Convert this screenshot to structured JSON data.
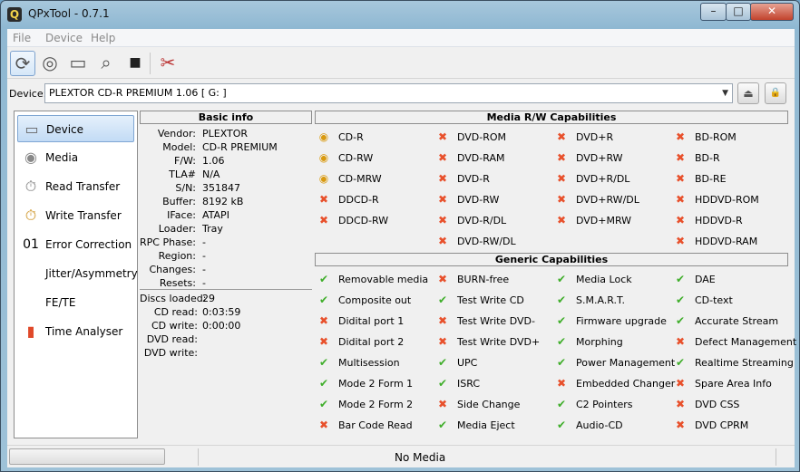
{
  "window": {
    "title": "QPxTool - 0.7.1",
    "app_icon_letter": "Q",
    "minimize": "–",
    "maximize": "□",
    "close": "✕"
  },
  "menu": [
    {
      "label": "File"
    },
    {
      "label": "Device"
    },
    {
      "label": "Help"
    }
  ],
  "toolbar": {
    "icons": [
      "refresh-icon",
      "disc-info-icon",
      "drive-icon",
      "scan-icon",
      "stop-icon",
      "settings-icon"
    ]
  },
  "device": {
    "label": "Device:",
    "value": "PLEXTOR  CD-R   PREMIUM   1.06 [ G: ]",
    "eject_label": "⏏",
    "lock_label": "🔒"
  },
  "sidebar": {
    "items": [
      {
        "label": "Device",
        "icon": "drive-icon",
        "active": true
      },
      {
        "label": "Media",
        "icon": "disc-icon"
      },
      {
        "label": "Read Transfer",
        "icon": "stopwatch-icon"
      },
      {
        "label": "Write Transfer",
        "icon": "stopwatch-burst-icon"
      },
      {
        "label": "Error Correction",
        "icon": "binary-icon",
        "icon_text": "01"
      },
      {
        "label": "Jitter/Asymmetry",
        "icon": ""
      },
      {
        "label": "FE/TE",
        "icon": ""
      },
      {
        "label": "Time Analyser",
        "icon": "bar-chart-icon"
      }
    ]
  },
  "basic_info": {
    "title": "Basic info",
    "rows": [
      {
        "key": "Vendor:",
        "value": "PLEXTOR"
      },
      {
        "key": "Model:",
        "value": "CD-R   PREMIUM"
      },
      {
        "key": "F/W:",
        "value": "1.06"
      },
      {
        "key": "TLA#",
        "value": "N/A"
      },
      {
        "key": "S/N:",
        "value": "351847"
      },
      {
        "key": "Buffer:",
        "value": "8192 kB"
      },
      {
        "key": "IFace:",
        "value": "ATAPI"
      },
      {
        "key": "Loader:",
        "value": "Tray"
      },
      {
        "key": "RPC Phase:",
        "value": "-"
      },
      {
        "key": "Region:",
        "value": "-"
      },
      {
        "key": "Changes:",
        "value": "-"
      },
      {
        "key": "Resets:",
        "value": "-"
      }
    ],
    "stats": [
      {
        "key": "Discs loaded:",
        "value": "29"
      },
      {
        "key": "CD read:",
        "value": "0:03:59"
      },
      {
        "key": "CD write:",
        "value": "0:00:00"
      },
      {
        "key": "DVD read:",
        "value": ""
      },
      {
        "key": "DVD write:",
        "value": ""
      }
    ]
  },
  "media_rw": {
    "title": "Media R/W Capabilities",
    "columns": [
      [
        {
          "label": "CD-R",
          "state": "read-write"
        },
        {
          "label": "CD-RW",
          "state": "read-write"
        },
        {
          "label": "CD-MRW",
          "state": "read-write"
        },
        {
          "label": "DDCD-R",
          "state": "no"
        },
        {
          "label": "DDCD-RW",
          "state": "no"
        }
      ],
      [
        {
          "label": "DVD-ROM",
          "state": "no"
        },
        {
          "label": "DVD-RAM",
          "state": "no"
        },
        {
          "label": "DVD-R",
          "state": "no"
        },
        {
          "label": "DVD-RW",
          "state": "no"
        },
        {
          "label": "DVD-R/DL",
          "state": "no"
        },
        {
          "label": "DVD-RW/DL",
          "state": "no"
        }
      ],
      [
        {
          "label": "DVD+R",
          "state": "no"
        },
        {
          "label": "DVD+RW",
          "state": "no"
        },
        {
          "label": "DVD+R/DL",
          "state": "no"
        },
        {
          "label": "DVD+RW/DL",
          "state": "no"
        },
        {
          "label": "DVD+MRW",
          "state": "no"
        }
      ],
      [
        {
          "label": "BD-ROM",
          "state": "no"
        },
        {
          "label": "BD-R",
          "state": "no"
        },
        {
          "label": "BD-RE",
          "state": "no"
        },
        {
          "label": "HDDVD-ROM",
          "state": "no"
        },
        {
          "label": "HDDVD-R",
          "state": "no"
        },
        {
          "label": "HDDVD-RAM",
          "state": "no"
        }
      ]
    ]
  },
  "generic": {
    "title": "Generic Capabilities",
    "columns": [
      [
        {
          "label": "Removable media",
          "state": "yes"
        },
        {
          "label": "Composite out",
          "state": "yes"
        },
        {
          "label": "Didital port 1",
          "state": "no"
        },
        {
          "label": "Didital port 2",
          "state": "no"
        },
        {
          "label": "Multisession",
          "state": "yes"
        },
        {
          "label": "Mode 2 Form 1",
          "state": "yes"
        },
        {
          "label": "Mode 2 Form 2",
          "state": "yes"
        },
        {
          "label": "Bar Code Read",
          "state": "no"
        }
      ],
      [
        {
          "label": "BURN-free",
          "state": "no"
        },
        {
          "label": "Test Write CD",
          "state": "yes"
        },
        {
          "label": "Test Write DVD-",
          "state": "no"
        },
        {
          "label": "Test Write DVD+",
          "state": "no"
        },
        {
          "label": "UPC",
          "state": "yes"
        },
        {
          "label": "ISRC",
          "state": "yes"
        },
        {
          "label": "Side Change",
          "state": "no"
        },
        {
          "label": "Media Eject",
          "state": "yes"
        }
      ],
      [
        {
          "label": "Media Lock",
          "state": "yes"
        },
        {
          "label": "S.M.A.R.T.",
          "state": "yes"
        },
        {
          "label": "Firmware upgrade",
          "state": "yes"
        },
        {
          "label": "Morphing",
          "state": "yes"
        },
        {
          "label": "Power Management",
          "state": "yes"
        },
        {
          "label": "Embedded Changer",
          "state": "no"
        },
        {
          "label": "C2 Pointers",
          "state": "yes"
        },
        {
          "label": "Audio-CD",
          "state": "yes"
        }
      ],
      [
        {
          "label": "DAE",
          "state": "yes"
        },
        {
          "label": "CD-text",
          "state": "yes"
        },
        {
          "label": "Accurate Stream",
          "state": "yes"
        },
        {
          "label": "Defect Management",
          "state": "no"
        },
        {
          "label": "Realtime Streaming",
          "state": "yes"
        },
        {
          "label": "Spare Area Info",
          "state": "no"
        },
        {
          "label": "DVD CSS",
          "state": "no"
        },
        {
          "label": "DVD CPRM",
          "state": "no"
        }
      ]
    ]
  },
  "statusbar": {
    "message": "No Media",
    "progress": 0
  },
  "colors": {
    "accent": "#c2dbf5",
    "no": "#e8502b",
    "yes": "#3fae2a",
    "disc": "#d99a10"
  }
}
